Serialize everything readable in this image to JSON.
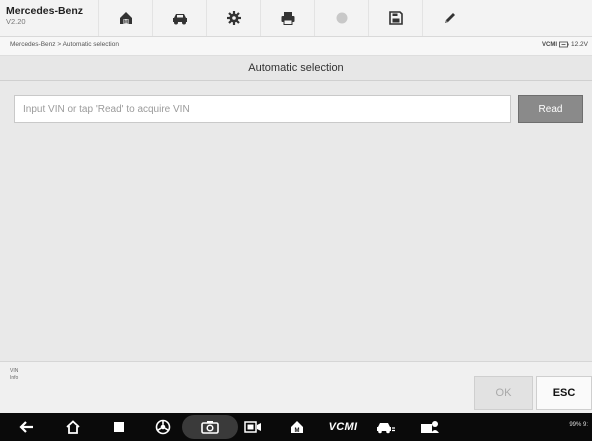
{
  "header": {
    "app_title": "Mercedes-Benz",
    "version": "V2.20",
    "toolbar_icons": [
      "home-icon",
      "vehicle-icon",
      "settings-icon",
      "print-icon",
      "help-icon",
      "save-icon",
      "edit-icon"
    ]
  },
  "breadcrumb": {
    "text": "Mercedes-Benz > Automatic selection",
    "vcmi_label": "VCMI",
    "voltage": "12.2V"
  },
  "page": {
    "title": "Automatic selection"
  },
  "vin": {
    "placeholder": "Input VIN or tap 'Read' to acquire VIN",
    "value": "",
    "read_label": "Read"
  },
  "info": {
    "line1": "VIN",
    "line2": "Info"
  },
  "actions": {
    "ok_label": "OK",
    "esc_label": "ESC"
  },
  "android_nav": {
    "vcmi_label": "VCMI",
    "status_text": "99% 9:"
  },
  "colors": {
    "read_button": "#8a8a8a",
    "content_bg": "#e9e9e9",
    "nav_bg": "#0a0a0a"
  }
}
